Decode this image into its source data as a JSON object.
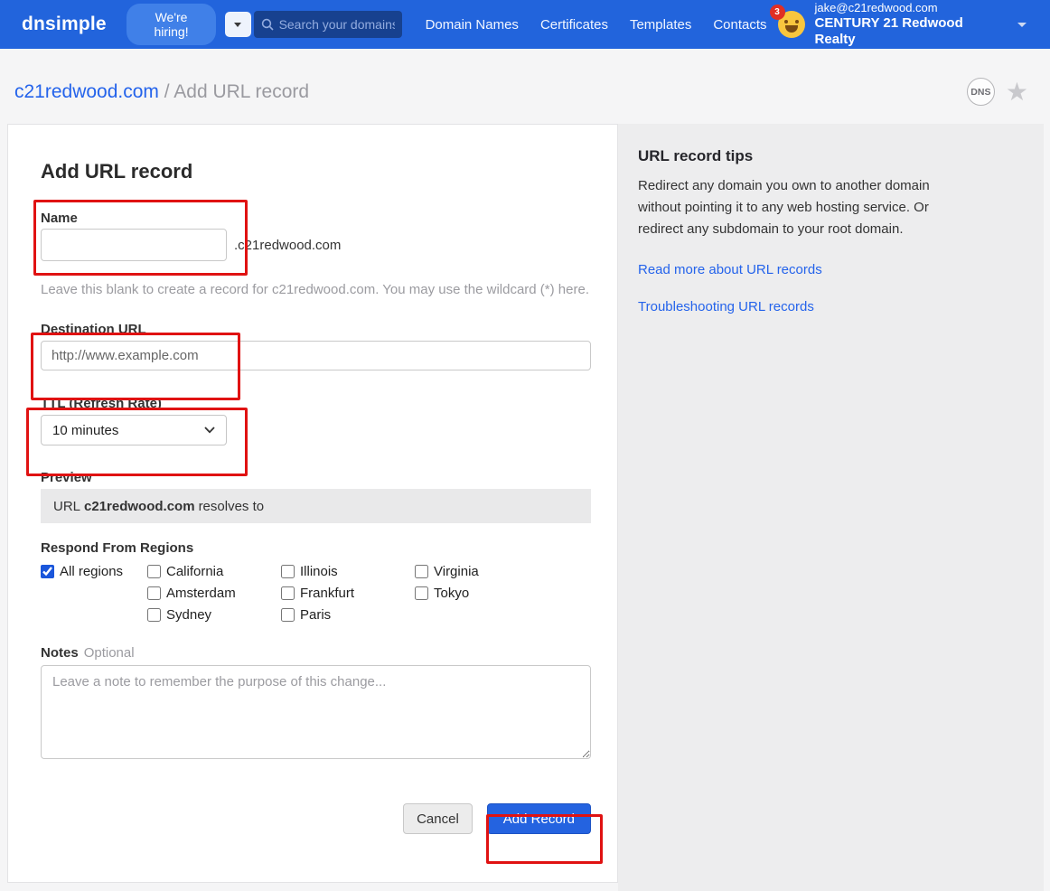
{
  "colors": {
    "navbar_bg": "#2264dc",
    "search_bg": "#17418f",
    "accent_blue": "#2463eb",
    "annotation_red": "#e01212",
    "sidebar_bg": "#ededee",
    "badge_red": "#e02f24"
  },
  "navbar": {
    "brand": "dnsimple",
    "hiring_label": "We're hiring!",
    "search_placeholder": "Search your domains",
    "links": [
      "Domain Names",
      "Certificates",
      "Templates",
      "Contacts"
    ],
    "notification_count": "3",
    "user_email": "jake@c21redwood.com",
    "account_name": "CENTURY 21 Redwood Realty"
  },
  "breadcrumb": {
    "domain": "c21redwood.com",
    "separator": " / ",
    "page_title": "Add URL record"
  },
  "header_icons": {
    "dns_badge": "DNS",
    "star": "★"
  },
  "form": {
    "title": "Add URL record",
    "name_label": "Name",
    "name_value": "",
    "name_suffix": ".c21redwood.com",
    "name_help": "Leave this blank to create a record for c21redwood.com. You may use the wildcard (*) here.",
    "destination_label": "Destination URL",
    "destination_placeholder": "http://www.example.com",
    "ttl_label": "TTL (Refresh Rate)",
    "ttl_value": "10 minutes",
    "preview_label": "Preview",
    "preview_prefix": "URL",
    "preview_domain": "c21redwood.com",
    "preview_suffix": "resolves to",
    "regions_label": "Respond From Regions",
    "regions": {
      "col1": [
        {
          "label": "All regions",
          "checked": true
        }
      ],
      "col2": [
        {
          "label": "California",
          "checked": false
        },
        {
          "label": "Amsterdam",
          "checked": false
        },
        {
          "label": "Sydney",
          "checked": false
        }
      ],
      "col3": [
        {
          "label": "Illinois",
          "checked": false
        },
        {
          "label": "Frankfurt",
          "checked": false
        },
        {
          "label": "Paris",
          "checked": false
        }
      ],
      "col4": [
        {
          "label": "Virginia",
          "checked": false
        },
        {
          "label": "Tokyo",
          "checked": false
        }
      ]
    },
    "notes_label": "Notes",
    "notes_optional": "Optional",
    "notes_placeholder": "Leave a note to remember the purpose of this change...",
    "cancel_label": "Cancel",
    "submit_label": "Add Record"
  },
  "tips": {
    "title": "URL record tips",
    "body": "Redirect any domain you own to another domain without pointing it to any web hosting service. Or redirect any subdomain to your root domain.",
    "link_read_more": "Read more about URL records",
    "link_troubleshooting": "Troubleshooting URL records"
  }
}
